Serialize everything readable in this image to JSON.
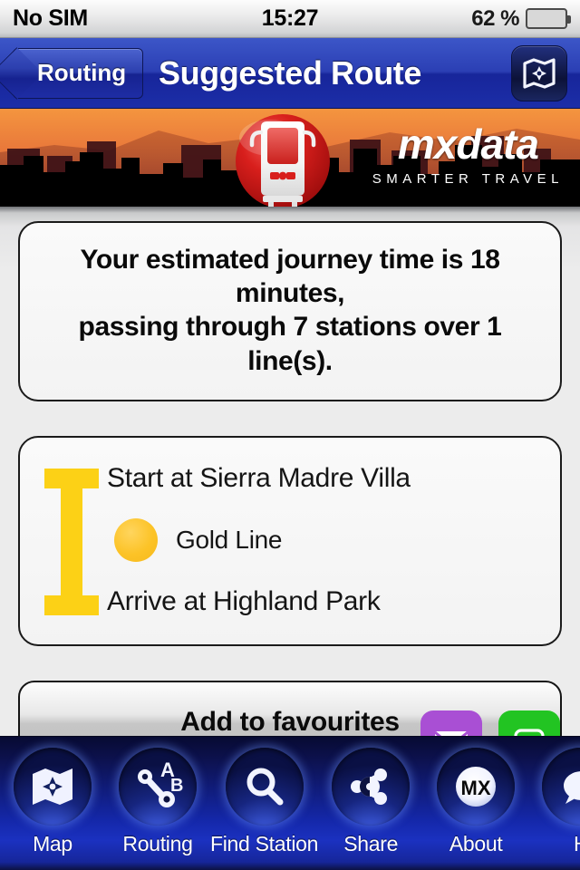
{
  "status_bar": {
    "carrier": "No SIM",
    "time": "15:27",
    "battery_percent": "62 %",
    "battery_level": 62
  },
  "nav_bar": {
    "back_label": "Routing",
    "title": "Suggested Route",
    "map_button_icon": "map-compass-icon"
  },
  "banner": {
    "logo_word": "mxdata",
    "logo_tagline": "SMARTER TRAVEL",
    "train_icon": "tram-front-icon",
    "sky_color": "#f08438",
    "skyline_color": "#000000"
  },
  "summary": {
    "line1": "Your estimated journey time is 18 minutes,",
    "line2": "passing through 7 stations over 1 line(s).",
    "journey_minutes": 18,
    "stations": 7,
    "lines": 1
  },
  "route": {
    "start_label": "Start at Sierra Madre Villa",
    "line_label": "Gold Line",
    "line_color": "#fcc327",
    "arrive_label": "Arrive at Highland Park",
    "bar_color": "#fcd116"
  },
  "favourites_button": {
    "label": "Add to favourites"
  },
  "share_buttons": [
    {
      "name": "mail",
      "icon": "envelope-icon",
      "color": "#a94fd4"
    },
    {
      "name": "message",
      "icon": "message-icon",
      "color": "#22c422"
    }
  ],
  "tab_bar": {
    "items": [
      {
        "label": "Map",
        "icon": "map-compass-icon"
      },
      {
        "label": "Routing",
        "icon": "route-a-to-b-icon"
      },
      {
        "label": "Find Station",
        "icon": "magnifier-icon"
      },
      {
        "label": "Share",
        "icon": "share-nodes-icon"
      },
      {
        "label": "About",
        "icon": "mx-logo-icon"
      },
      {
        "label": "H",
        "icon": "speech-bubble-icon"
      }
    ],
    "routing_icon_labels": {
      "a": "A",
      "b": "B"
    },
    "about_icon_text": "MX"
  }
}
